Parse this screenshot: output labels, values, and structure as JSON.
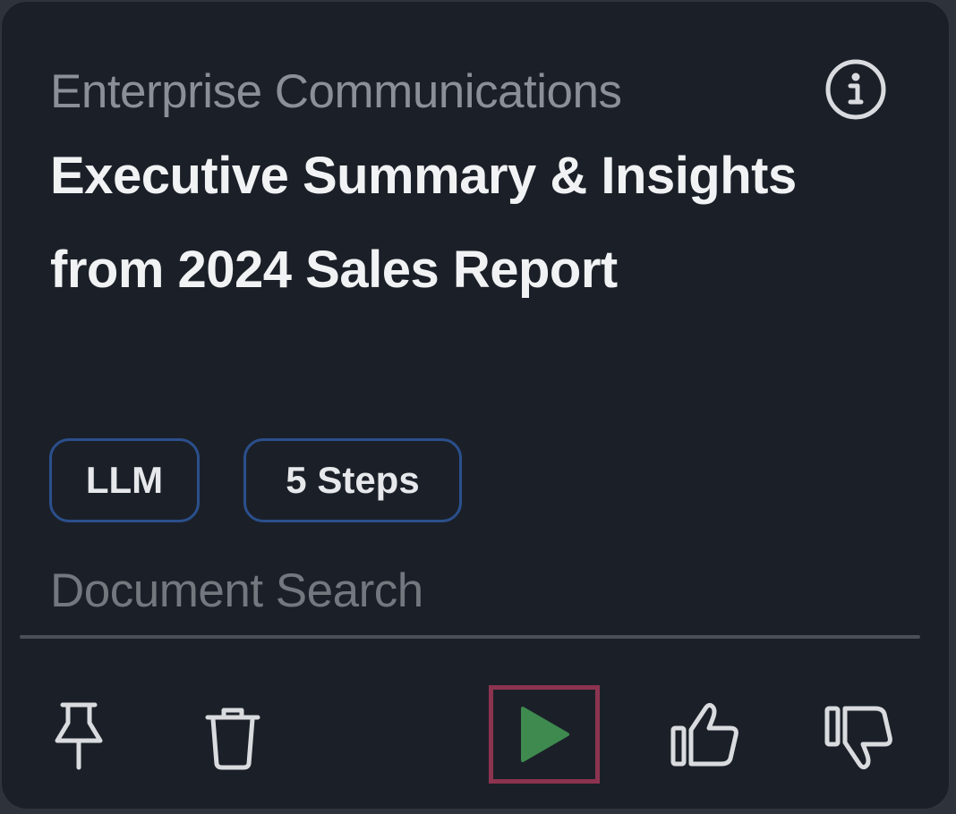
{
  "card": {
    "category": "Enterprise Communications",
    "title": "Executive Summary & Insights from 2024 Sales Report",
    "tags": [
      "LLM",
      "5 Steps"
    ],
    "subcategory": "Document Search"
  },
  "icons": {
    "info": "info-icon",
    "pin": "pin-icon",
    "trash": "trash-icon",
    "run": "play-icon",
    "like": "thumbs-up-icon",
    "dislike": "thumbs-down-icon"
  },
  "colors": {
    "background": "#1b2028",
    "play": "#3e8a4f",
    "tag_border": "#2b4f8c",
    "highlight": "#8c3350"
  }
}
